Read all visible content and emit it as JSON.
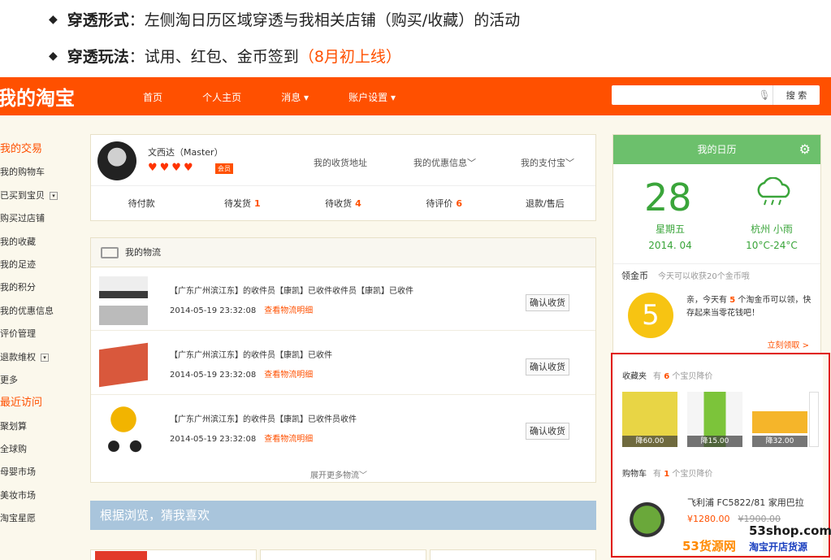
{
  "bullets": [
    {
      "title": "穿透形式",
      "text": "：左侧淘日历区域穿透与我相关店铺（购买/收藏）的活动",
      "hi": ""
    },
    {
      "title": "穿透玩法",
      "text": "：试用、红包、金币签到",
      "hi": "（8月初上线）"
    }
  ],
  "header": {
    "logo": "我的淘宝",
    "nav": [
      "首页",
      "个人主页",
      "消息 ▾",
      "账户设置 ▾"
    ],
    "search_btn": "搜 索"
  },
  "sidebar": {
    "items": [
      "我的交易",
      "我的购物车",
      "已买到宝贝",
      "购买过店铺",
      "我的收藏",
      "我的足迹",
      "我的积分",
      "我的优惠信息",
      "评价管理",
      "退款维权",
      "更多",
      "最近访问",
      "聚划算",
      "全球购",
      "母婴市场",
      "美妆市场",
      "淘宝星愿"
    ]
  },
  "user": {
    "name": "文西达（Master）",
    "badge": "会员",
    "links": [
      "我的收货地址",
      "我的优惠信息﹀",
      "我的支付宝﹀"
    ],
    "stats": [
      {
        "label": "待付款",
        "n": ""
      },
      {
        "label": "待发货",
        "n": "1"
      },
      {
        "label": "待收货",
        "n": "4"
      },
      {
        "label": "待评价",
        "n": "6"
      },
      {
        "label": "退款/售后",
        "n": ""
      }
    ]
  },
  "logistics": {
    "title": "我的物流",
    "rows": [
      {
        "text": "【广东广州滨江东】的收件员【康凯】已收件收件员【康凯】已收件",
        "date": "2014-05-19 23:32:08",
        "link": "查看物流明细",
        "btn": "确认收货"
      },
      {
        "text": "【广东广州滨江东】的收件员【康凯】已收件",
        "date": "2014-05-19 23:32:08",
        "link": "查看物流明细",
        "btn": "确认收货"
      },
      {
        "text": "【广东广州滨江东】的收件员【康凯】已收件员收件",
        "date": "2014-05-19 23:32:08",
        "link": "查看物流明细",
        "btn": "确认收货"
      }
    ],
    "more": "展开更多物流﹀"
  },
  "guess": {
    "title": "根据浏览，猜我喜欢"
  },
  "calendar": {
    "title": "我的日历",
    "day": "28",
    "weekday": "星期五",
    "month": "2014. 04",
    "city": "杭州 小雨",
    "temp": "10°C-24°C",
    "coin_label": "领金币",
    "coin_tip": "今天可以收获20个金币哦",
    "coin_num": "5",
    "coin_msg_a": "亲，今天有 ",
    "coin_msg_n": "5",
    "coin_msg_b": " 个淘金币可以领，快存起来当零花钱吧！",
    "claim": "立刻领取 >"
  },
  "fav": {
    "label": "收藏夹",
    "pre": "有 ",
    "n": "6",
    "post": " 个宝贝降价",
    "items": [
      "降60.00",
      "降15.00",
      "降32.00"
    ]
  },
  "cart": {
    "label": "购物车",
    "pre": "有 ",
    "n": "1",
    "post": " 个宝贝降价",
    "product": "飞利浦 FC5822/81 家用巴拉",
    "price": "¥1280.00",
    "old": "¥1900.00"
  },
  "watermark": {
    "site": "53shop.com",
    "brand": "53货源网",
    "slogan": "淘宝开店货源"
  }
}
